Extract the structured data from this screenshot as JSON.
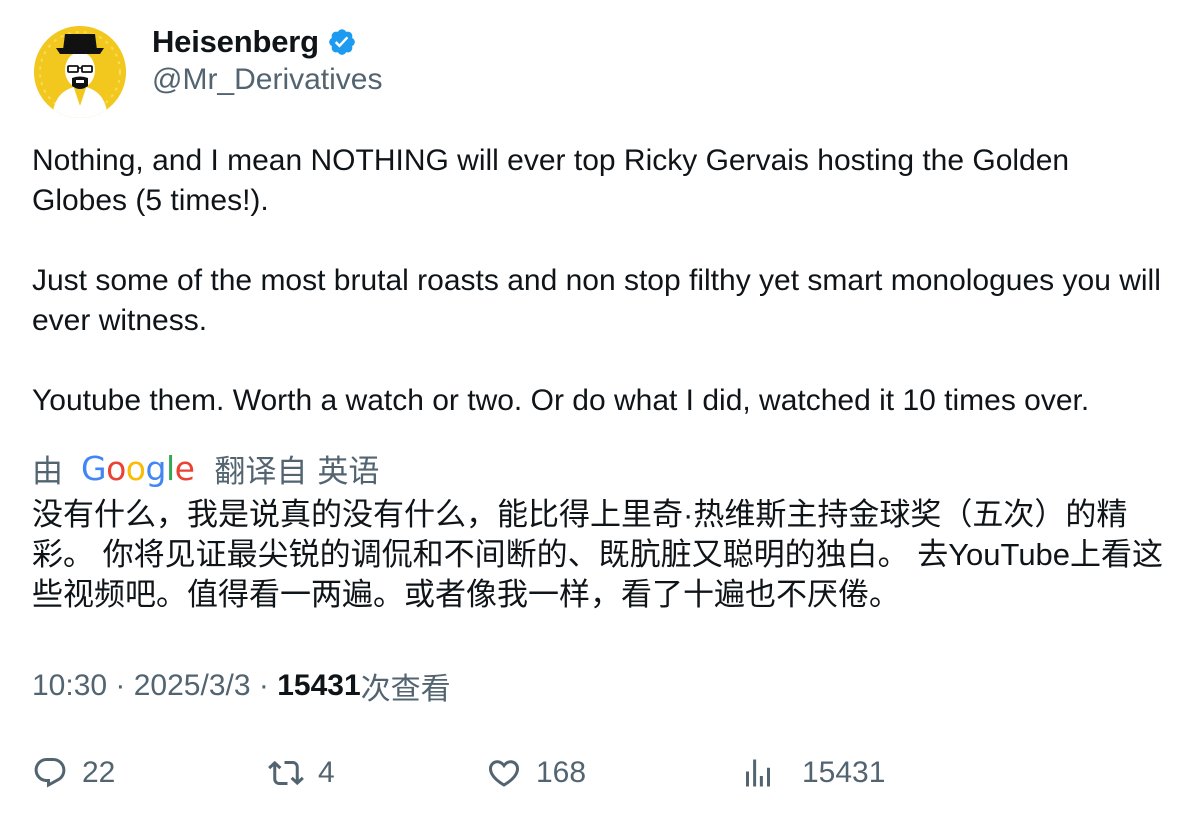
{
  "author": {
    "name": "Heisenberg",
    "handle": "@Mr_Derivatives",
    "verified": true
  },
  "tweet": {
    "paragraphs": [
      "Nothing, and I mean NOTHING will ever top Ricky Gervais hosting the Golden Globes (5 times!).",
      "Just some of the most brutal roasts and non stop filthy yet smart monologues you will ever witness.",
      "Youtube them. Worth a watch or two. Or do what I did, watched it 10 times over."
    ]
  },
  "translation": {
    "by_label": "由",
    "provider": "Google",
    "translated_from": "翻译自",
    "source_language": "英语",
    "text": "没有什么，我是说真的没有什么，能比得上里奇·热维斯主持金球奖（五次）的精彩。 你将见证最尖锐的调侃和不间断的、既肮脏又聪明的独白。 去YouTube上看这些视频吧。值得看一两遍。或者像我一样，看了十遍也不厌倦。"
  },
  "meta": {
    "time": "10:30",
    "separator": " · ",
    "date": "2025/3/3",
    "views_count": "15431",
    "views_label": "次查看"
  },
  "actions": {
    "reply_count": "22",
    "retweet_count": "4",
    "like_count": "168",
    "views_count": "15431"
  },
  "colors": {
    "text_primary": "#0f1419",
    "text_secondary": "#536471",
    "verified_blue": "#1d9bf0",
    "avatar_background": "#f2c81f"
  },
  "icons": {
    "verified": "verified-badge-icon",
    "reply": "reply-icon",
    "retweet": "retweet-icon",
    "like": "heart-icon",
    "views": "views-bar-chart-icon"
  }
}
